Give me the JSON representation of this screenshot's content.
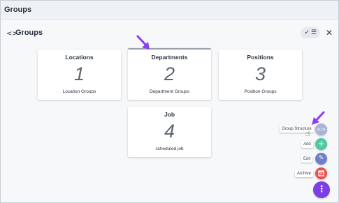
{
  "page": {
    "title": "Groups"
  },
  "header": {
    "icon": "code-icon",
    "title": "Groups"
  },
  "toolbar": {
    "check_icon": "check-icon",
    "menu_icon": "hamburger-icon",
    "close_icon": "close-icon"
  },
  "cards": [
    {
      "title": "Locations",
      "count": "1",
      "subtitle": "Location Groups"
    },
    {
      "title": "Departments",
      "count": "2",
      "subtitle": "Department Groups"
    },
    {
      "title": "Positions",
      "count": "3",
      "subtitle": "Position Groups"
    },
    {
      "title": "Job",
      "count": "4",
      "subtitle": "scheduled job"
    }
  ],
  "fab_menu": {
    "items": [
      {
        "label": "Group Structure",
        "icon": "code-icon",
        "color": "#a9b3d6"
      },
      {
        "label": "Add",
        "icon": "plus-icon",
        "color": "#4dc9a0"
      },
      {
        "label": "Edit",
        "icon": "pencil-icon",
        "color": "#6f7fc9"
      },
      {
        "label": "Archive",
        "icon": "archive-icon",
        "color": "#ef4d4d"
      }
    ],
    "main": {
      "icon": "more-vertical-icon",
      "color": "#7b3fe4"
    }
  },
  "colors": {
    "annotation_arrow": "#8a3ff0"
  }
}
